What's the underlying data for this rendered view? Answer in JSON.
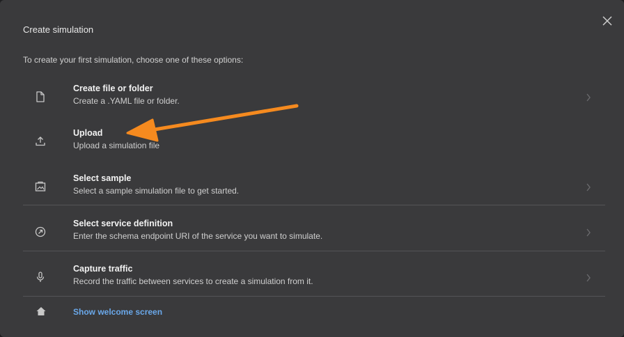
{
  "dialog": {
    "title": "Create simulation",
    "intro": "To create your first simulation, choose one of these options:"
  },
  "options": [
    {
      "label": "Create file or folder",
      "desc": "Create a .YAML file or folder.",
      "icon": "file-icon"
    },
    {
      "label": "Upload",
      "desc": "Upload a simulation file",
      "icon": "upload-icon"
    },
    {
      "label": "Select sample",
      "desc": "Select a sample simulation file to get started.",
      "icon": "image-sample-icon"
    },
    {
      "label": "Select service definition",
      "desc": "Enter the schema endpoint URI of the service you want to simulate.",
      "icon": "compass-icon"
    },
    {
      "label": "Capture traffic",
      "desc": "Record the traffic between services to create a simulation from it.",
      "icon": "microphone-icon"
    }
  ],
  "welcome": {
    "label": "Show welcome screen",
    "icon": "home-icon"
  },
  "colors": {
    "accent_link": "#6aa8ea",
    "annotation_arrow": "#f58a1f",
    "panel": "#3a3a3c"
  }
}
